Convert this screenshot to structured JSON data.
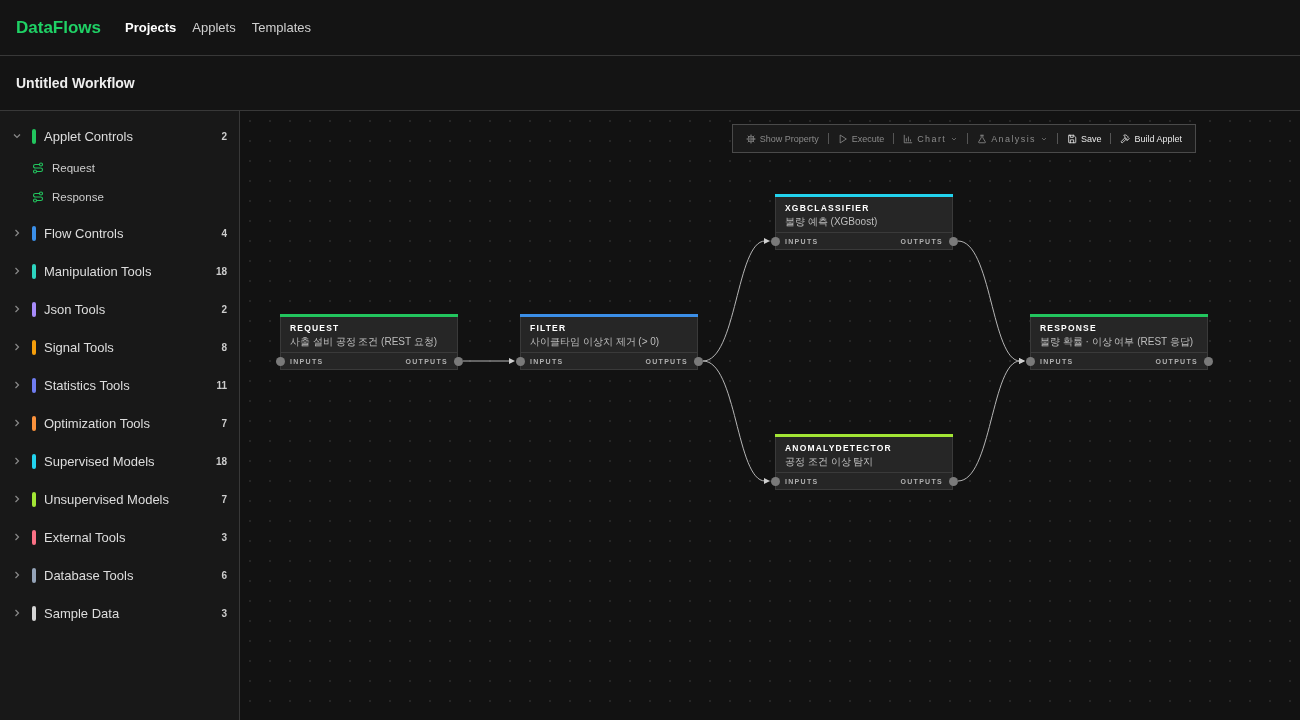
{
  "header": {
    "logo": "DataFlows",
    "nav": [
      {
        "label": "Projects",
        "selected": true
      },
      {
        "label": "Applets",
        "selected": false
      },
      {
        "label": "Templates",
        "selected": false
      }
    ]
  },
  "workflow": {
    "title": "Untitled Workflow"
  },
  "sidebar": {
    "groups": [
      {
        "label": "Applet Controls",
        "count": "2",
        "color": "#22c55e",
        "expanded": true,
        "children": [
          {
            "label": "Request"
          },
          {
            "label": "Response"
          }
        ]
      },
      {
        "label": "Flow Controls",
        "count": "4",
        "color": "#3b8fe8",
        "expanded": false
      },
      {
        "label": "Manipulation Tools",
        "count": "18",
        "color": "#2dd4bf",
        "expanded": false
      },
      {
        "label": "Json Tools",
        "count": "2",
        "color": "#a78bfa",
        "expanded": false
      },
      {
        "label": "Signal Tools",
        "count": "8",
        "color": "#f59e0b",
        "expanded": false
      },
      {
        "label": "Statistics Tools",
        "count": "11",
        "color": "#6f7cf0",
        "expanded": false
      },
      {
        "label": "Optimization Tools",
        "count": "7",
        "color": "#fb923c",
        "expanded": false
      },
      {
        "label": "Supervised Models",
        "count": "18",
        "color": "#22d3ee",
        "expanded": false
      },
      {
        "label": "Unsupervised Models",
        "count": "7",
        "color": "#a3e635",
        "expanded": false
      },
      {
        "label": "External Tools",
        "count": "3",
        "color": "#fb7185",
        "expanded": false
      },
      {
        "label": "Database Tools",
        "count": "6",
        "color": "#94a3b8",
        "expanded": false
      },
      {
        "label": "Sample Data",
        "count": "3",
        "color": "#d4d4d4",
        "expanded": false
      }
    ]
  },
  "toolbar": {
    "items": [
      {
        "kind": "button",
        "label": "Show Property",
        "disabled": true
      },
      {
        "kind": "button",
        "label": "Execute",
        "disabled": true
      },
      {
        "kind": "dropdown",
        "label": "Chart",
        "disabled": true
      },
      {
        "kind": "dropdown",
        "label": "Analysis",
        "disabled": true
      },
      {
        "kind": "button",
        "label": "Save",
        "disabled": false
      },
      {
        "kind": "button",
        "label": "Build Applet",
        "disabled": false
      }
    ]
  },
  "canvas": {
    "nodes": [
      {
        "title": "REQUEST",
        "description": "사출 설비 공정 조건 (REST 요청)",
        "color": "#22c55e",
        "inputs_label": "INPUTS",
        "outputs_label": "OUTPUTS"
      },
      {
        "title": "FILTER",
        "description": "사이클타임 이상치 제거 (> 0)",
        "color": "#3b8fe8",
        "inputs_label": "INPUTS",
        "outputs_label": "OUTPUTS"
      },
      {
        "title": "XGBCLASSIFIER",
        "description": "불량 예측 (XGBoost)",
        "color": "#22d3ee",
        "inputs_label": "INPUTS",
        "outputs_label": "OUTPUTS"
      },
      {
        "title": "ANOMALYDETECTOR",
        "description": "공정 조건 이상 탐지",
        "color": "#a3e635",
        "inputs_label": "INPUTS",
        "outputs_label": "OUTPUTS"
      },
      {
        "title": "RESPONSE",
        "description": "불량 확률 · 이상 여부 (REST 응답)",
        "color": "#22c55e",
        "inputs_label": "INPUTS",
        "outputs_label": "OUTPUTS"
      }
    ]
  }
}
